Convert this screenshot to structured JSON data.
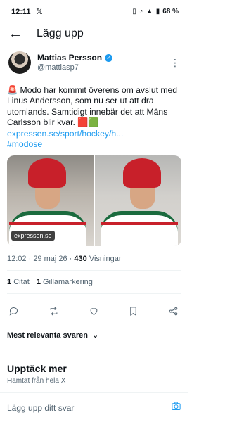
{
  "status_bar": {
    "time": "12:11",
    "app_icon": "𝕏",
    "battery": "68 %",
    "icons": [
      "vibrate-icon",
      "wifi-icon",
      "signal-icon",
      "battery-icon"
    ]
  },
  "header": {
    "title": "Lägg upp",
    "back_icon": "arrow-left-icon"
  },
  "post": {
    "author_name": "Mattias Persson",
    "author_handle": "@mattiasp7",
    "text_main": "🚨 Modo har kommit överens om avslut med Linus Andersson, som nu ser ut att dra utomlands. Samtidigt innebär det att Måns Carlsson blir kvar. 🟥🟩",
    "link": "expressen.se/sport/hockey/h...",
    "hashtag": "#modose",
    "media_badge": "expressen.se",
    "time": "12:02",
    "date": "29 maj 26",
    "views_count": "430",
    "views_label": "Visningar",
    "quotes_count": "1",
    "quotes_label": "Citat",
    "likes_count": "1",
    "likes_label": "Gillamarkering"
  },
  "sort": {
    "label": "Mest relevanta svaren"
  },
  "discover": {
    "title": "Upptäck mer",
    "subtitle": "Hämtat från hela X"
  },
  "reply": {
    "placeholder": "Lägg upp ditt svar"
  },
  "colors": {
    "accent": "#1d9bf0",
    "text": "#0f1419",
    "secondary": "#536471"
  }
}
